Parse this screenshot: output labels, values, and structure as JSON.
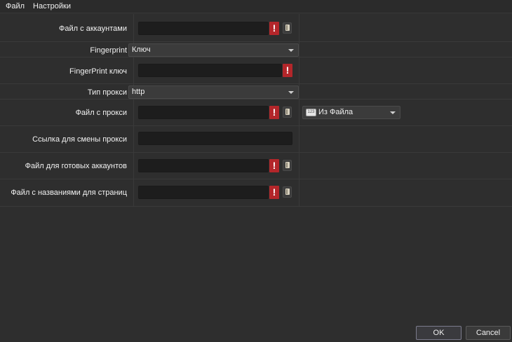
{
  "menu": {
    "file": "Файл",
    "settings": "Настройки"
  },
  "fields": {
    "accounts_file": {
      "label": "Файл с аккаунтами",
      "value": ""
    },
    "fingerprint": {
      "label": "Fingerprint",
      "selected": "Ключ"
    },
    "fingerprint_key": {
      "label": "FingerPrint ключ",
      "value": ""
    },
    "proxy_type": {
      "label": "Тип прокси",
      "selected": "http"
    },
    "proxy_file": {
      "label": "Файл с прокси",
      "value": "",
      "source": "Из Файла",
      "source_icon": "123"
    },
    "proxy_change_link": {
      "label": "Ссылка для смены прокси",
      "value": ""
    },
    "ready_accounts_file": {
      "label": "Файл для готовых аккаунтов",
      "value": ""
    },
    "page_names_file": {
      "label": "Файл с названиями для страниц",
      "value": ""
    }
  },
  "warning_mark": "!",
  "buttons": {
    "ok": "OK",
    "cancel": "Cancel"
  },
  "colors": {
    "warning": "#b3262a",
    "background": "#2e2e2e",
    "field": "#1d1d1d"
  }
}
